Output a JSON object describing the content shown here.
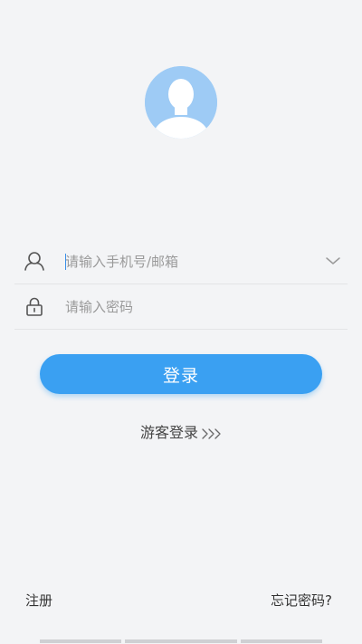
{
  "avatar": {
    "icon": "default-user-avatar-icon",
    "color": "#9ecbf5"
  },
  "form": {
    "account": {
      "icon": "user-icon",
      "placeholder": "请输入手机号/邮箱",
      "value": "",
      "dropdown_icon": "chevron-down-icon"
    },
    "password": {
      "icon": "lock-icon",
      "placeholder": "请输入密码",
      "value": ""
    }
  },
  "login_button": {
    "label": "登录",
    "color": "#3aa0f2"
  },
  "guest_login": {
    "label": "游客登录",
    "icon": "triple-chevron-right-icon"
  },
  "footer": {
    "register_label": "注册",
    "forgot_label": "忘记密码?"
  }
}
